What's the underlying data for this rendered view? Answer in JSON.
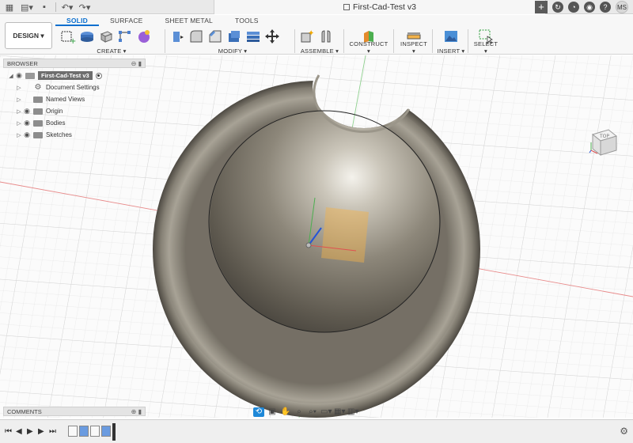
{
  "window": {
    "doc_title": "First-Cad-Test v3",
    "user_initials": "MS"
  },
  "toolbar": {
    "design_label": "DESIGN ▾",
    "tabs": [
      "SOLID",
      "SURFACE",
      "SHEET METAL",
      "TOOLS"
    ],
    "groups": {
      "create": "CREATE ▾",
      "modify": "MODIFY ▾",
      "assemble": "ASSEMBLE ▾",
      "construct": "CONSTRUCT ▾",
      "inspect": "INSPECT ▾",
      "insert": "INSERT ▾",
      "select": "SELECT ▾"
    }
  },
  "browser": {
    "title": "BROWSER",
    "root": "First-Cad-Test v3",
    "items": [
      "Document Settings",
      "Named Views",
      "Origin",
      "Bodies",
      "Sketches"
    ]
  },
  "viewcube": {
    "face": "TOP"
  },
  "comments": {
    "title": "COMMENTS"
  },
  "colors": {
    "accent": "#0a6fcf",
    "x_axis": "#e05050",
    "y_axis": "#4caf50",
    "body_metal": "#8a8577",
    "sketch_plane": "#f2b24a"
  }
}
